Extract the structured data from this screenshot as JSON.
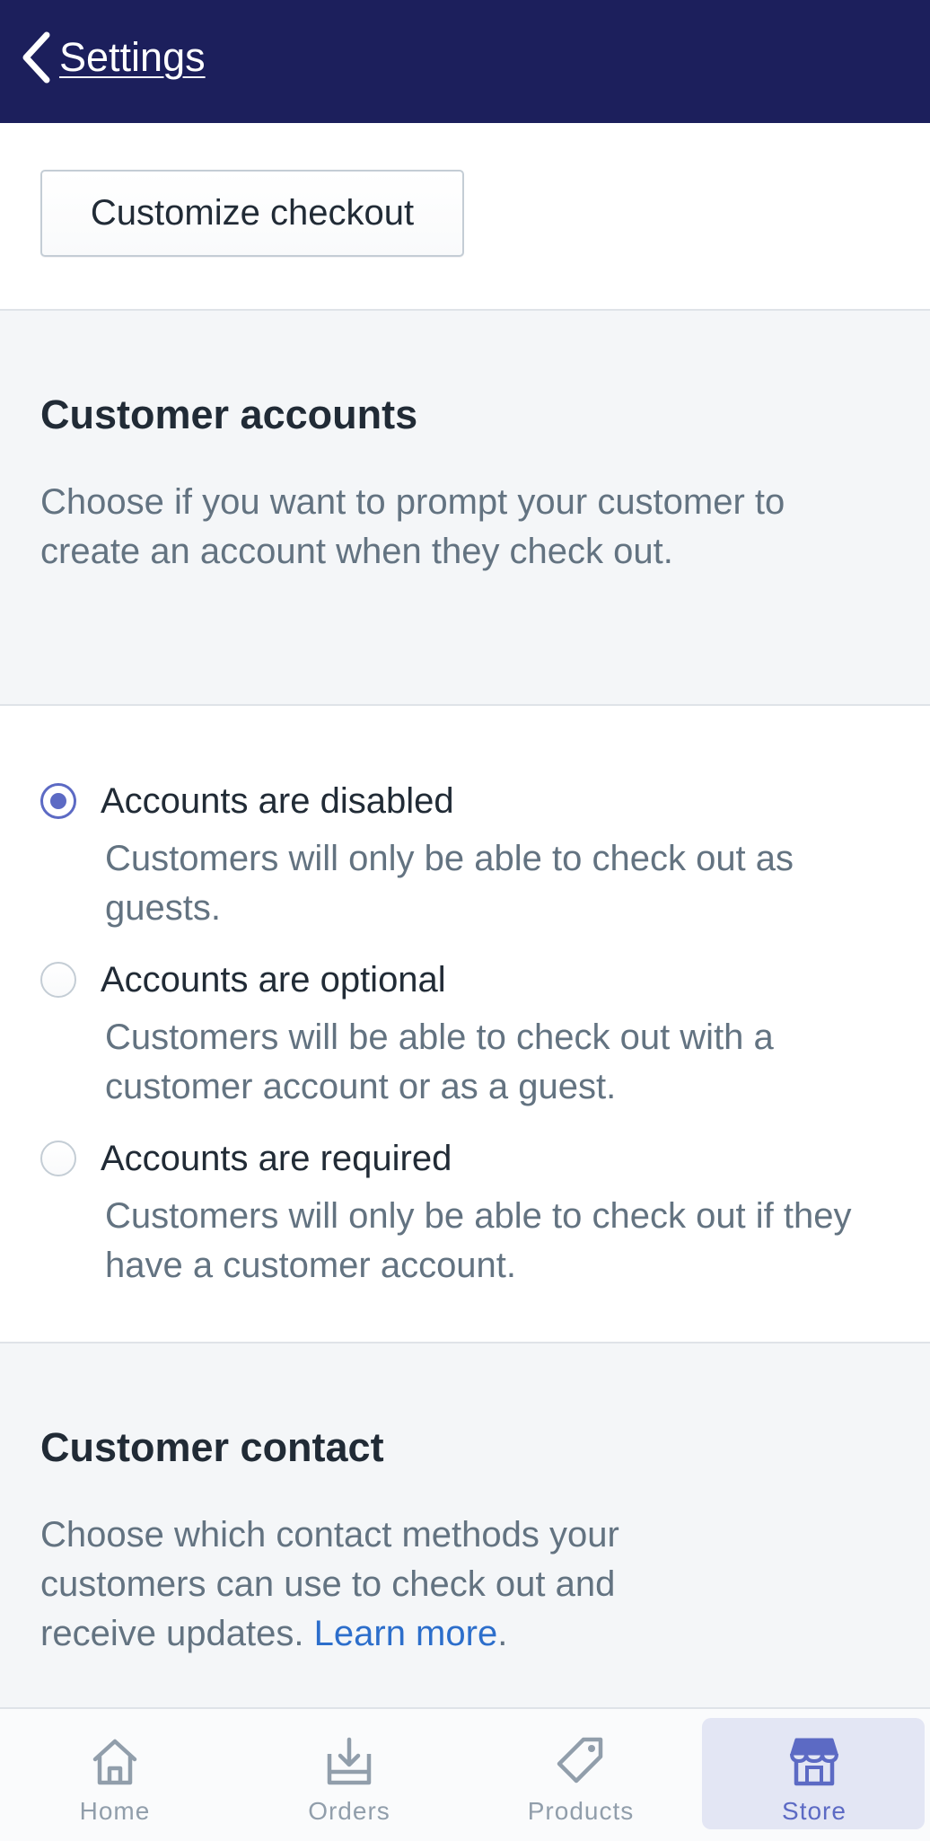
{
  "header": {
    "back_label": "Settings",
    "back_icon": "chevron-left-icon"
  },
  "checkout": {
    "customize_button": "Customize checkout"
  },
  "customer_accounts": {
    "title": "Customer accounts",
    "description": "Choose if you want to prompt your customer to create an account when they check out.",
    "selected": "disabled",
    "options": [
      {
        "label": "Accounts are disabled",
        "help": "Customers will only be able to check out as guests.",
        "checked": true
      },
      {
        "label": "Accounts are optional",
        "help": "Customers will be able to check out with a customer account or as a guest.",
        "checked": false
      },
      {
        "label": "Accounts are required",
        "help": "Customers will only be able to check out if they have a customer account.",
        "checked": false
      }
    ]
  },
  "customer_contact": {
    "title": "Customer contact",
    "description": "Choose which contact methods your customers can use to check out and receive updates.",
    "learn_more": "Learn more",
    "trailing": "."
  },
  "bottom_nav": {
    "active": "Store",
    "items": [
      {
        "label": "Home",
        "icon": "home-icon"
      },
      {
        "label": "Orders",
        "icon": "orders-inbox-icon"
      },
      {
        "label": "Products",
        "icon": "tag-icon"
      },
      {
        "label": "Store",
        "icon": "store-icon"
      }
    ]
  },
  "colors": {
    "header_bg": "#1c1f5c",
    "accent": "#5c6ac4",
    "link": "#2c6ecb",
    "page_bg": "#f4f6f8",
    "subdued_text": "#637381",
    "nav_active_bg": "#e3e6f4"
  }
}
